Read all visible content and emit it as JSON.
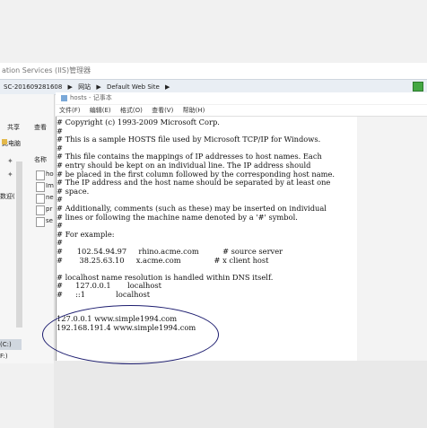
{
  "iis": {
    "title": "ation Services (IIS)管理器",
    "address": [
      "SC-201609281608",
      "▶",
      "网站",
      "▶",
      "Default Web Site",
      "▶"
    ]
  },
  "explorer": {
    "tab_share": "共享",
    "tab_view": "查看",
    "location": "此电脑",
    "col_name": "名称",
    "items": [
      "ho",
      "Im",
      "ne",
      "pr",
      "se"
    ],
    "side_label": "数迎(",
    "drive": "(C:)",
    "drive2": "F:)"
  },
  "notepad": {
    "title": "hosts - 记事本",
    "menu": [
      "文件(F)",
      "编辑(E)",
      "格式(O)",
      "查看(V)",
      "帮助(H)"
    ],
    "content": "# Copyright (c) 1993-2009 Microsoft Corp.\n#\n# This is a sample HOSTS file used by Microsoft TCP/IP for Windows.\n#\n# This file contains the mappings of IP addresses to host names. Each\n# entry should be kept on an individual line. The IP address should\n# be placed in the first column followed by the corresponding host name.\n# The IP address and the host name should be separated by at least one\n# space.\n#\n# Additionally, comments (such as these) may be inserted on individual\n# lines or following the machine name denoted by a '#' symbol.\n#\n# For example:\n#\n#      102.54.94.97     rhino.acme.com          # source server\n#       38.25.63.10     x.acme.com              # x client host\n\n# localhost name resolution is handled within DNS itself.\n#\t127.0.0.1       localhost\n#\t::1             localhost",
    "entries": "127.0.0.1 www.simple1994.com\n192.168.191.4 www.simple1994.com"
  }
}
